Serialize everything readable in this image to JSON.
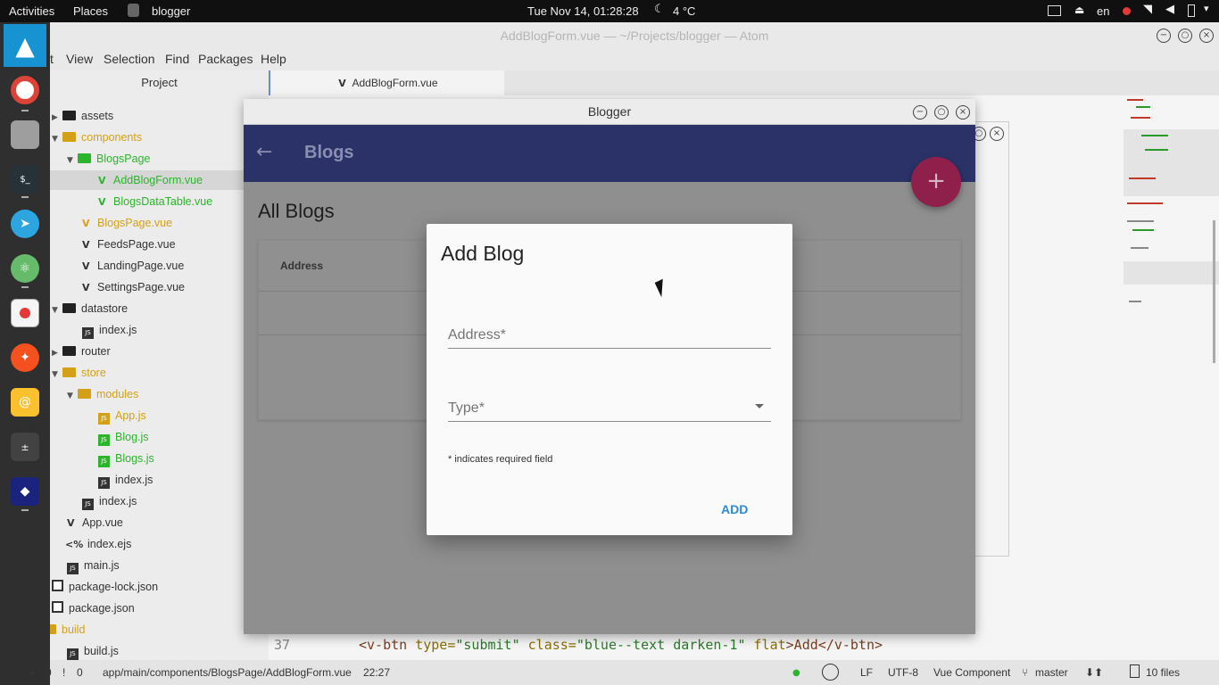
{
  "topbar": {
    "activities": "Activities",
    "places": "Places",
    "app_name": "blogger",
    "clock": "Tue Nov 14, 01:28:28",
    "weather": "4 °C",
    "lang": "en"
  },
  "dock": {
    "items": [
      "archlinux-icon",
      "chrome-icon",
      "files-icon",
      "terminal-icon",
      "telegram-icon",
      "atom-icon",
      "editor-icon",
      "rocket-icon",
      "mail-icon",
      "calculator-icon",
      "ide-icon"
    ]
  },
  "atom": {
    "title": "AddBlogForm.vue — ~/Projects/blogger — Atom",
    "menu": [
      "t",
      "View",
      "Selection",
      "Find",
      "Packages",
      "Help"
    ],
    "tree_header": "Project",
    "tree": [
      {
        "label": "assets",
        "kind": "folder",
        "color": "dark"
      },
      {
        "label": "components",
        "kind": "folder",
        "color": "orange"
      },
      {
        "label": "BlogsPage",
        "kind": "folder",
        "color": "green"
      },
      {
        "label": "AddBlogForm.vue",
        "kind": "vue",
        "color": "green"
      },
      {
        "label": "BlogsDataTable.vue",
        "kind": "vue",
        "color": "green"
      },
      {
        "label": "BlogsPage.vue",
        "kind": "vue",
        "color": "orange"
      },
      {
        "label": "FeedsPage.vue",
        "kind": "vue",
        "color": "dark"
      },
      {
        "label": "LandingPage.vue",
        "kind": "vue",
        "color": "dark"
      },
      {
        "label": "SettingsPage.vue",
        "kind": "vue",
        "color": "dark"
      },
      {
        "label": "datastore",
        "kind": "folder",
        "color": "dark"
      },
      {
        "label": "index.js",
        "kind": "js",
        "color": "dark"
      },
      {
        "label": "router",
        "kind": "folder",
        "color": "dark"
      },
      {
        "label": "store",
        "kind": "folder",
        "color": "orange"
      },
      {
        "label": "modules",
        "kind": "folder",
        "color": "orange"
      },
      {
        "label": "App.js",
        "kind": "js",
        "color": "orange"
      },
      {
        "label": "Blog.js",
        "kind": "js",
        "color": "green"
      },
      {
        "label": "Blogs.js",
        "kind": "js",
        "color": "green"
      },
      {
        "label": "index.js",
        "kind": "js",
        "color": "dark"
      },
      {
        "label": "index.js",
        "kind": "js",
        "color": "dark"
      },
      {
        "label": "App.vue",
        "kind": "vue",
        "color": "dark"
      },
      {
        "label": "index.ejs",
        "kind": "ejs",
        "color": "dark"
      },
      {
        "label": "main.js",
        "kind": "js",
        "color": "dark"
      },
      {
        "label": "package-lock.json",
        "kind": "json",
        "color": "dark"
      },
      {
        "label": "package.json",
        "kind": "json",
        "color": "dark"
      },
      {
        "label": "build",
        "kind": "folder",
        "color": "orange"
      },
      {
        "label": "build.js",
        "kind": "js",
        "color": "dark"
      }
    ],
    "tab_label": "AddBlogForm.vue",
    "code_line": {
      "number": "37",
      "tag_open": "<v-btn ",
      "attr1": "type=",
      "val1": "\"submit\"",
      "attr2": " class=",
      "val2": "\"blue--text darken-1\"",
      "attr3": " flat",
      "rest": ">Add</v-btn>"
    },
    "status": {
      "errors": "0",
      "warnings": "0",
      "path": "app/main/components/BlogsPage/AddBlogForm.vue",
      "cursor": "22:27",
      "line_ending": "LF",
      "encoding": "UTF-8",
      "grammar": "Vue Component",
      "branch": "master",
      "files": "10 files"
    }
  },
  "blogger": {
    "title": "Blogger",
    "toolbar_title": "Blogs",
    "section_title": "All Blogs",
    "table_header": "Address",
    "fab_label": "+",
    "colors": {
      "toolbar": "#2a3268",
      "fab": "#8f1f4b",
      "accent": "#2d8bd5"
    }
  },
  "dialog": {
    "title": "Add Blog",
    "address_label": "Address*",
    "type_label": "Type*",
    "required_note": "* indicates required field",
    "add_button": "ADD"
  }
}
